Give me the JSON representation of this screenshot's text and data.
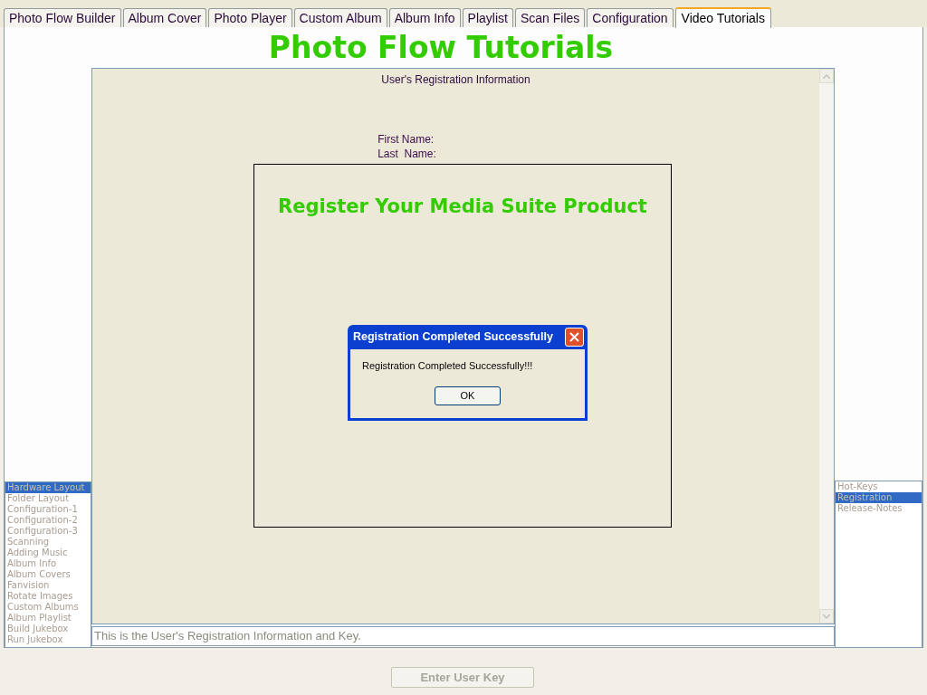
{
  "tabs": [
    {
      "label": "Photo Flow Builder",
      "selected": false
    },
    {
      "label": "Album Cover",
      "selected": false
    },
    {
      "label": "Photo Player",
      "selected": false
    },
    {
      "label": "Custom Album",
      "selected": false
    },
    {
      "label": "Album Info",
      "selected": false
    },
    {
      "label": "Playlist",
      "selected": false
    },
    {
      "label": "Scan Files",
      "selected": false
    },
    {
      "label": "Configuration",
      "selected": false
    },
    {
      "label": "Video Tutorials",
      "selected": true
    }
  ],
  "page_title": "Photo Flow Tutorials",
  "content": {
    "heading": "User's Registration Information",
    "fields": [
      "First Name:",
      "Last  Name:"
    ]
  },
  "overlay": {
    "title": "Register Your Media Suite Product"
  },
  "dialog": {
    "title": "Registration Completed Successfully",
    "message": "Registration Completed Successfully!!!",
    "button": "OK"
  },
  "left_list": [
    {
      "label": "Hardware Layout",
      "selected": true
    },
    {
      "label": "Folder Layout",
      "selected": false
    },
    {
      "label": "Configuration-1",
      "selected": false
    },
    {
      "label": "Configuration-2",
      "selected": false
    },
    {
      "label": "Configuration-3",
      "selected": false
    },
    {
      "label": "Scanning",
      "selected": false
    },
    {
      "label": "Adding Music",
      "selected": false
    },
    {
      "label": "Album Info",
      "selected": false
    },
    {
      "label": "Album Covers",
      "selected": false
    },
    {
      "label": "Fanvision",
      "selected": false
    },
    {
      "label": "Rotate Images",
      "selected": false
    },
    {
      "label": "Custom Albums",
      "selected": false
    },
    {
      "label": "Album Playlist",
      "selected": false
    },
    {
      "label": "Build Jukebox",
      "selected": false
    },
    {
      "label": "Run Jukebox",
      "selected": false
    }
  ],
  "right_list": [
    {
      "label": "Hot-Keys",
      "selected": false
    },
    {
      "label": "Registration",
      "selected": true
    },
    {
      "label": "Release-Notes",
      "selected": false
    }
  ],
  "status_text": "This is the User's Registration Information and Key.",
  "bottom_button": {
    "label": "Enter User Key",
    "disabled": true
  }
}
